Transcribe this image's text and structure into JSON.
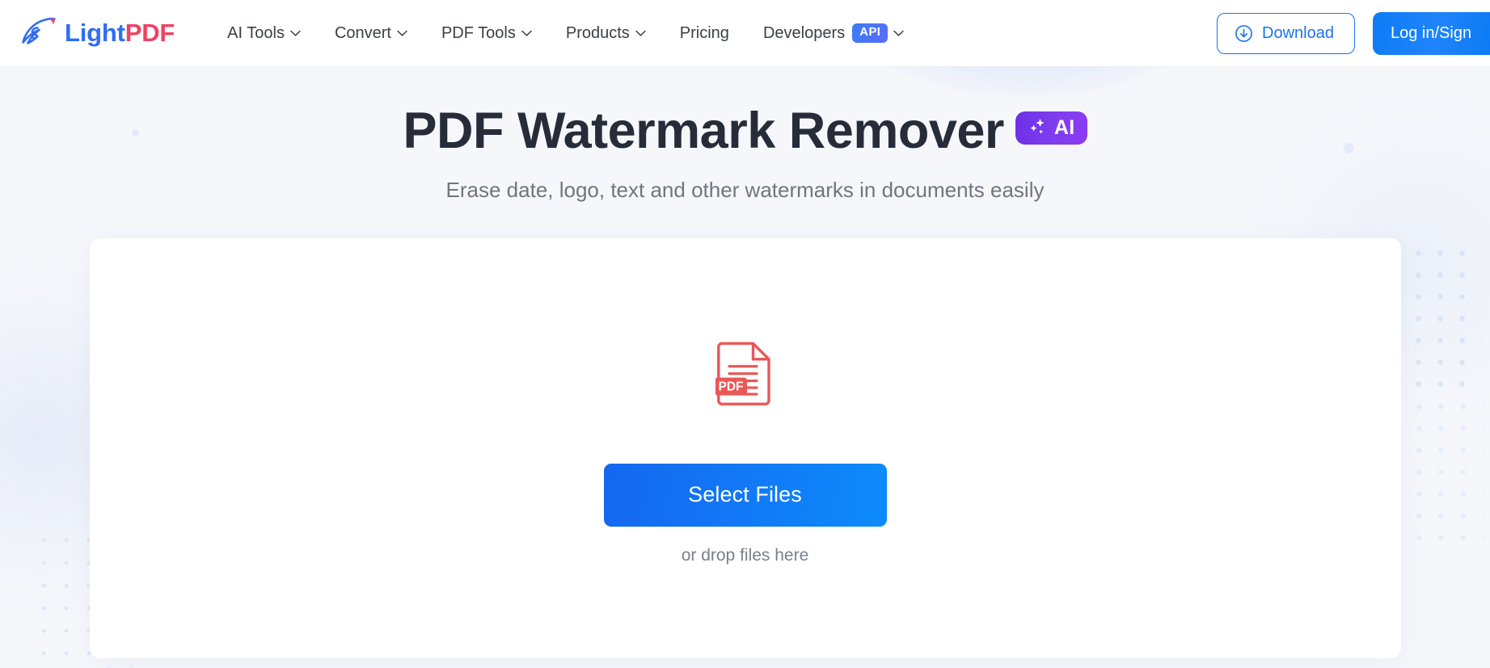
{
  "header": {
    "logo": {
      "icon": "lightpdf-rocket-logo-icon",
      "text_light": "Light",
      "text_pdf": "PDF"
    },
    "nav": [
      {
        "label": "AI Tools",
        "has_dropdown": true,
        "icon": "chevron-down-icon"
      },
      {
        "label": "Convert",
        "has_dropdown": true,
        "icon": "chevron-down-icon"
      },
      {
        "label": "PDF Tools",
        "has_dropdown": true,
        "icon": "chevron-down-icon"
      },
      {
        "label": "Products",
        "has_dropdown": true,
        "icon": "chevron-down-icon"
      },
      {
        "label": "Pricing",
        "has_dropdown": false
      },
      {
        "label": "Developers",
        "has_dropdown": true,
        "badge": "API",
        "icon": "chevron-down-icon"
      }
    ],
    "download_button": {
      "label": "Download",
      "icon": "download-circle-icon"
    },
    "login_button": {
      "label": "Log in/Sign"
    }
  },
  "hero": {
    "title": "PDF Watermark Remover",
    "ai_badge": {
      "label": "AI",
      "icon": "sparkles-icon"
    },
    "subtitle": "Erase date, logo, text and other watermarks in documents easily"
  },
  "upload": {
    "file_icon": {
      "name": "pdf-file-icon",
      "label": "PDF"
    },
    "select_button_label": "Select Files",
    "drop_hint": "or drop files here"
  },
  "colors": {
    "brand_blue": "#1a73f0",
    "brand_red": "#ef4264",
    "page_background": "#f6f7fb",
    "header_background": "#ffffff",
    "title_text": "#262c38",
    "subtitle_text": "#70757f",
    "ai_badge_purple": "#7d3bee",
    "pdf_icon_red": "#eb5757"
  }
}
